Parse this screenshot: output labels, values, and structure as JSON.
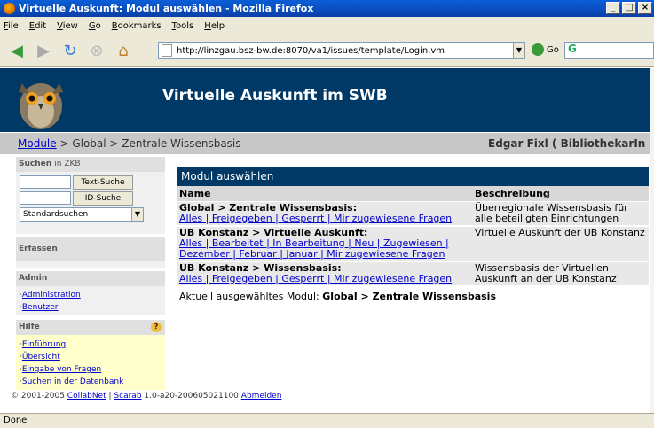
{
  "window": {
    "title": "Virtuelle Auskunft: Modul auswählen - Mozilla Firefox"
  },
  "menu": [
    "File",
    "Edit",
    "View",
    "Go",
    "Bookmarks",
    "Tools",
    "Help"
  ],
  "address": {
    "url": "http://linzgau.bsz-bw.de:8070/va1/issues/template/Login.vm",
    "go_label": "Go"
  },
  "banner": {
    "title": "Virtuelle Auskunft im SWB"
  },
  "breadcrumb": {
    "root": "Module",
    "rest": " > Global > Zentrale Wissensbasis",
    "user": "Edgar Fixl ( BibliothekarIn )"
  },
  "sidebar": {
    "search": {
      "head": "Suchen",
      "head_suffix": "in ZKB",
      "text_button": "Text-Suche",
      "id_button": "ID-Suche",
      "select_value": "Standardsuchen"
    },
    "capture": {
      "head": "Erfassen"
    },
    "admin": {
      "head": "Admin",
      "links": [
        "Administration",
        "Benutzer"
      ]
    },
    "help": {
      "head": "Hilfe",
      "links": [
        "Einführung",
        "Übersicht",
        "Eingabe von Fragen",
        "Suchen in der Datenbank"
      ]
    }
  },
  "main": {
    "title": "Modul auswählen",
    "col_name": "Name",
    "col_desc": "Beschreibung",
    "rows": [
      {
        "name": "Global > Zentrale Wissensbasis:",
        "links": "Alles | Freigegeben | Gesperrt | Mir zugewiesene Fragen",
        "desc": "Überregionale Wissensbasis für alle beteiligten Einrichtungen"
      },
      {
        "name": "UB Konstanz > Virtuelle Auskunft:",
        "links": "Alles | Bearbeitet | In Bearbeitung | Neu | Zugewiesen | Dezember | Februar | Januar | Mir zugewiesene Fragen",
        "desc": "Virtuelle Auskunft der UB Konstanz"
      },
      {
        "name": "UB Konstanz > Wissensbasis:",
        "links": "Alles | Freigegeben | Gesperrt | Mir zugewiesene Fragen",
        "desc": "Wissensbasis der Virtuellen Auskunft an der UB Konstanz"
      }
    ],
    "current_prefix": "Aktuell ausgewähltes Modul:",
    "current_module": "Global > Zentrale Wissensbasis"
  },
  "footer": {
    "copyright": "© 2001-2005",
    "collabnet": "CollabNet",
    "sep": "|",
    "scarab": "Scarab",
    "version": "1.0-a20-200605021100",
    "logout": "Abmelden"
  },
  "status": {
    "text": "Done"
  },
  "colors": {
    "banner": "#003866",
    "link": "#0000cc"
  }
}
